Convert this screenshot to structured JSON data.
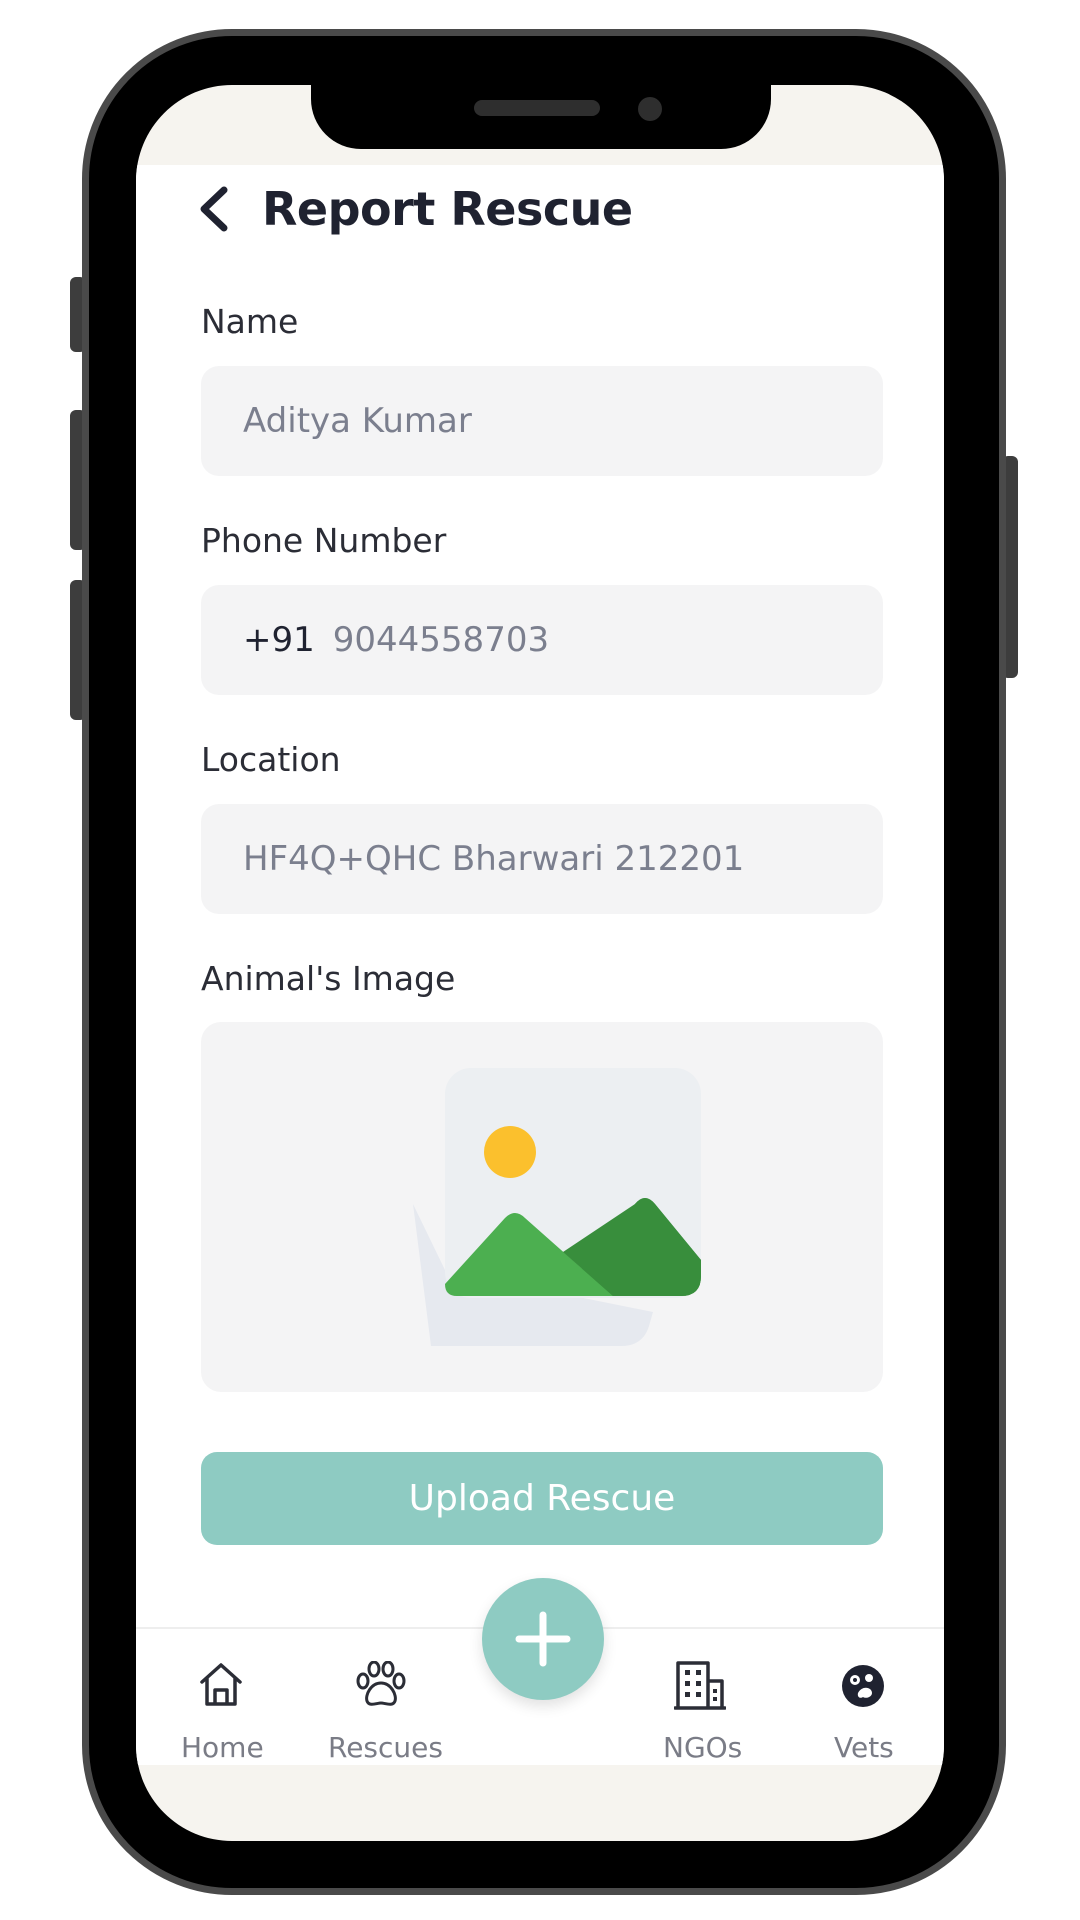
{
  "header": {
    "title": "Report Rescue"
  },
  "form": {
    "name": {
      "label": "Name",
      "value": "Aditya Kumar"
    },
    "phone": {
      "label": "Phone Number",
      "prefix": "+91",
      "value": "9044558703"
    },
    "location": {
      "label": "Location",
      "value": "HF4Q+QHC Bharwari 212201"
    },
    "image": {
      "label": "Animal's Image",
      "icon": "image-placeholder-icon"
    }
  },
  "upload_button": {
    "label": "Upload Rescue"
  },
  "bottom_nav": {
    "items": [
      {
        "label": "Home",
        "icon": "home-icon"
      },
      {
        "label": "Rescues",
        "icon": "paw-icon"
      },
      {
        "label": "NGOs",
        "icon": "building-icon"
      },
      {
        "label": "Vets",
        "icon": "vet-icon"
      }
    ],
    "fab_icon": "plus-icon"
  },
  "colors": {
    "accent": "#8ecbc2",
    "field_bg": "#f4f4f5",
    "text_dark": "#1f2230",
    "text_muted": "#7b7f8e"
  }
}
